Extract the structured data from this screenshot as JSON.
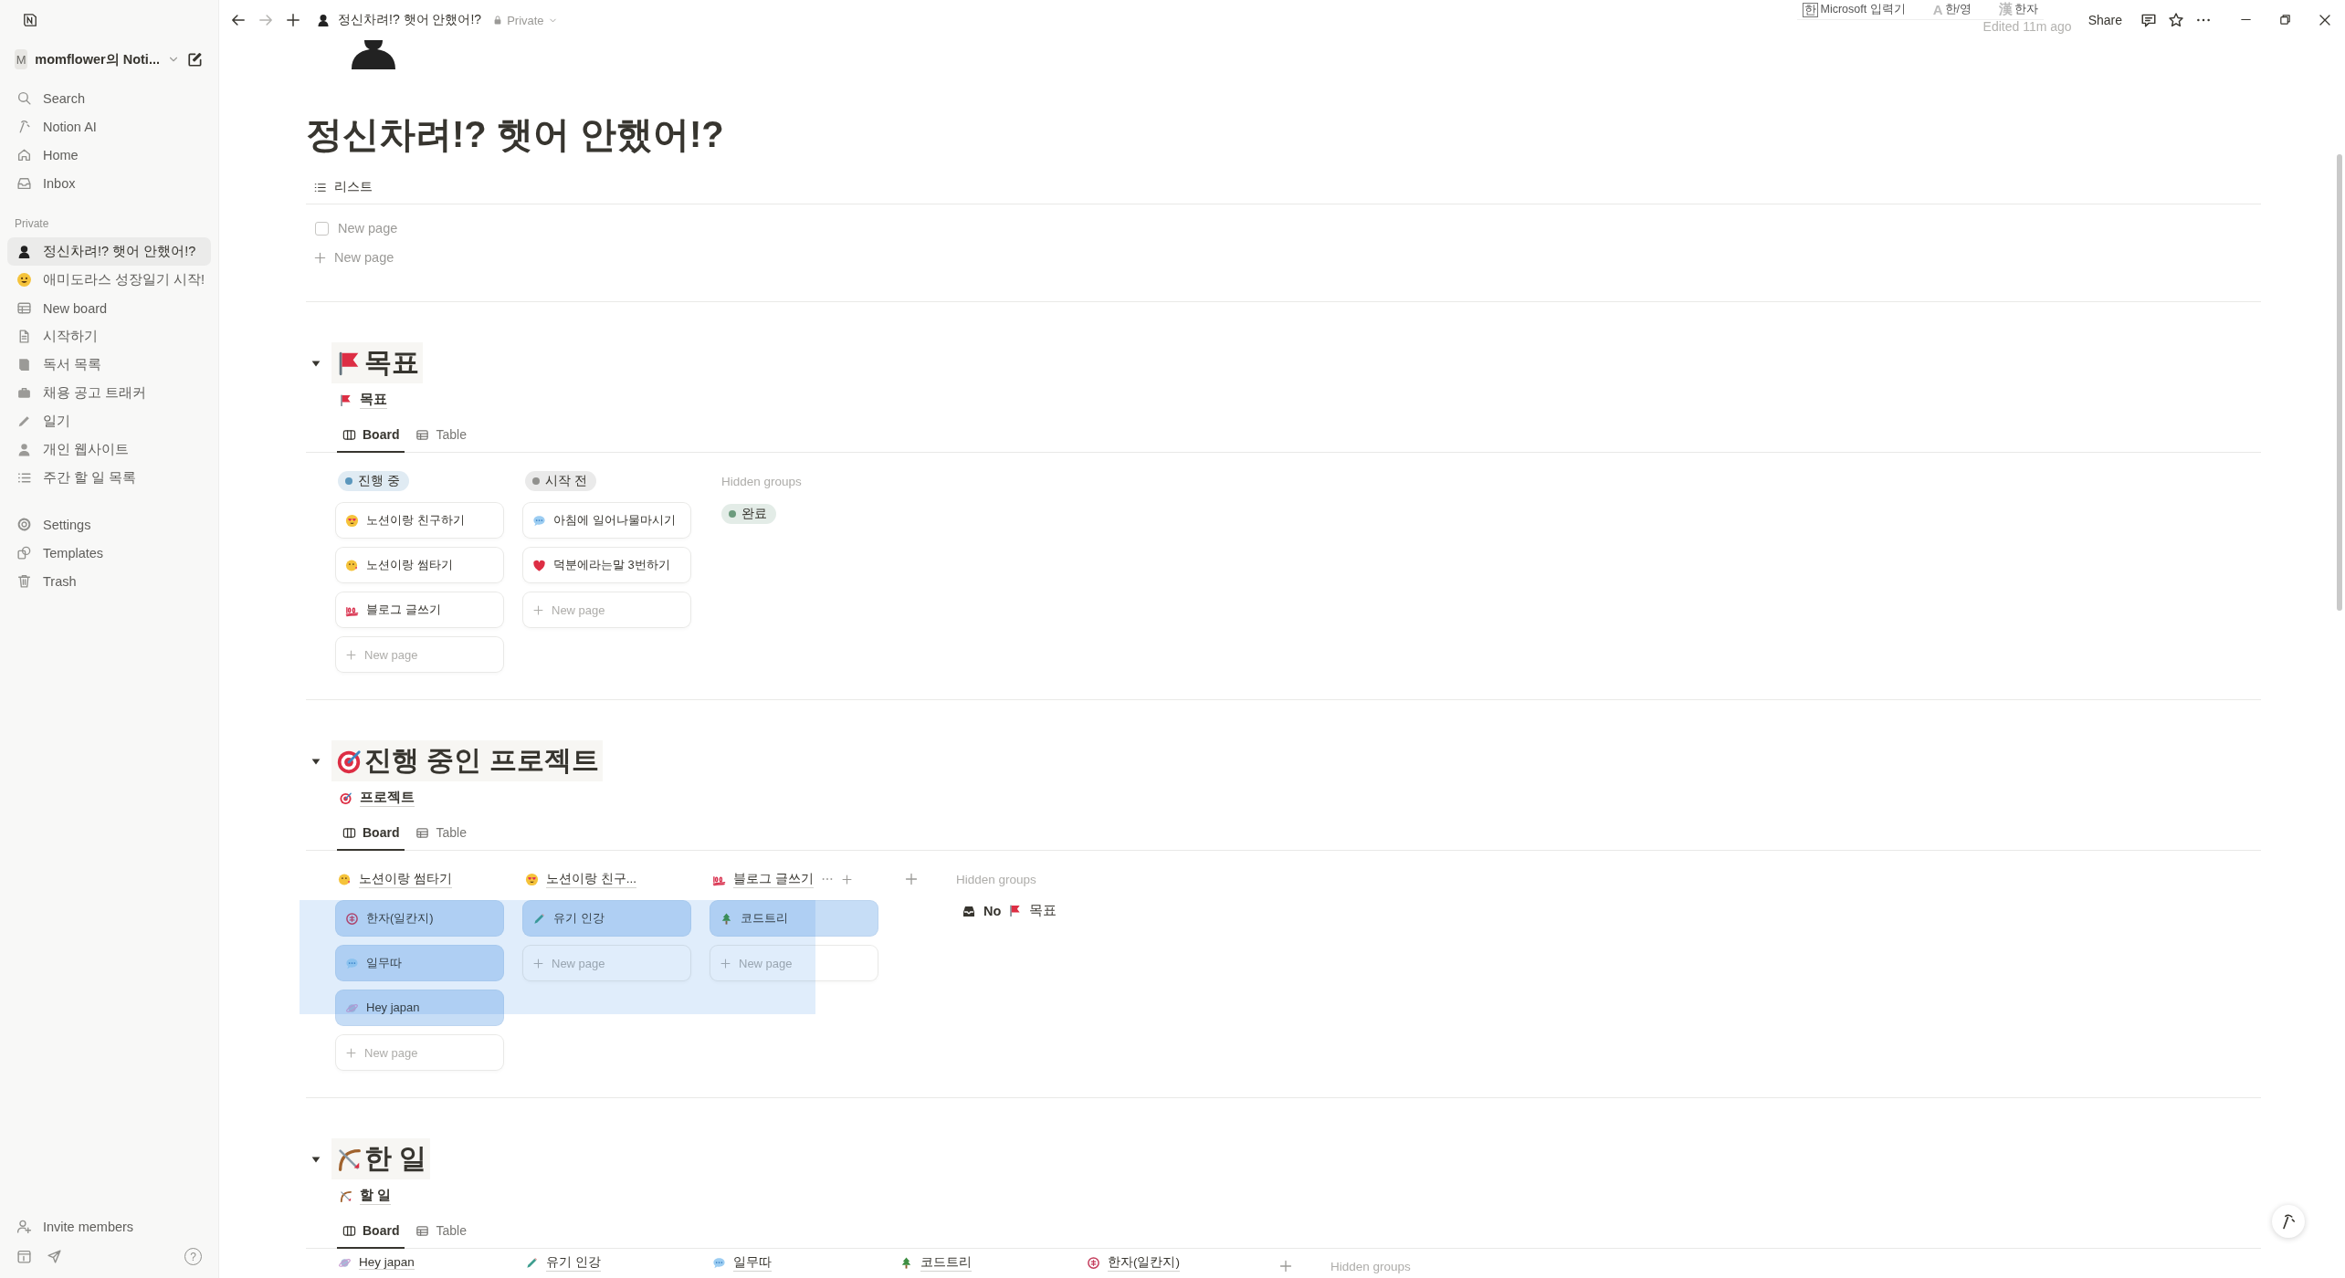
{
  "sidebar": {
    "workspace": {
      "initial": "M",
      "name": "momflower의 Noti..."
    },
    "nav": [
      {
        "label": "Search"
      },
      {
        "label": "Notion AI"
      },
      {
        "label": "Home"
      },
      {
        "label": "Inbox"
      }
    ],
    "section_label": "Private",
    "pages": [
      {
        "label": "정신차려!? 햇어 안했어!?",
        "selected": true
      },
      {
        "label": "애미도라스 성장일기 시작!",
        "selected": false
      },
      {
        "label": "New board",
        "selected": false
      },
      {
        "label": "시작하기",
        "selected": false
      },
      {
        "label": "독서 목록",
        "selected": false
      },
      {
        "label": "채용 공고 트래커",
        "selected": false
      },
      {
        "label": "일기",
        "selected": false
      },
      {
        "label": "개인 웹사이트",
        "selected": false
      },
      {
        "label": "주간 할 일 목록",
        "selected": false
      }
    ],
    "footer_nav": [
      {
        "label": "Settings"
      },
      {
        "label": "Templates"
      },
      {
        "label": "Trash"
      }
    ],
    "invite": "Invite members",
    "help": "?"
  },
  "topbar": {
    "breadcrumb": "정신차려!? 햇어 안했어!?",
    "privacy": "Private",
    "edited": "Edited 11m ago",
    "share": "Share"
  },
  "ime_bar": [
    {
      "glyph": "한",
      "label": "Microsoft 입력기"
    },
    {
      "glyph": "A",
      "label": "한/영"
    },
    {
      "glyph": "漢",
      "label": "한자"
    }
  ],
  "page": {
    "title": "정신차려!? 햇어 안했어!?",
    "list_view": {
      "tab": "리스트",
      "rows": [
        {
          "title": "New page",
          "checked": false
        }
      ],
      "add": "New page"
    },
    "sections": [
      {
        "heading": "목표",
        "expanded": true,
        "db_title": "목표",
        "views": [
          {
            "label": "Board",
            "selected": true
          },
          {
            "label": "Table",
            "selected": false
          }
        ],
        "add_group_button": false,
        "selection_rectangle": false,
        "groups": [
          {
            "kind": "status",
            "label": "진행 중",
            "color": "#5b97bd",
            "hovered": false,
            "cards": [
              {
                "title": "노션이랑 친구하기",
                "selected": false
              },
              {
                "title": "노션이랑 썸타기",
                "selected": false
              },
              {
                "title": "블로그 글쓰기",
                "selected": false
              }
            ],
            "add": "New page"
          },
          {
            "kind": "status",
            "label": "시작 전",
            "color": "#91918e",
            "hovered": false,
            "cards": [
              {
                "title": "아침에 일어나물마시기",
                "selected": false
              },
              {
                "title": "덕분에라는말 3번하기",
                "selected": false
              }
            ],
            "add": "New page"
          }
        ],
        "hidden_label": "Hidden groups",
        "hidden_groups": [
          {
            "kind": "status",
            "label": "완료",
            "color": "#6c9b7d"
          }
        ]
      },
      {
        "heading": "진행 중인 프로젝트",
        "expanded": true,
        "db_title": "프로젝트",
        "views": [
          {
            "label": "Board",
            "selected": true
          },
          {
            "label": "Table",
            "selected": false
          }
        ],
        "add_group_button": true,
        "selection_rectangle": true,
        "groups": [
          {
            "kind": "page",
            "label": "노션이랑 썸타기",
            "hovered": false,
            "cards": [
              {
                "title": "한자(일칸지)",
                "selected": true
              },
              {
                "title": "일무따",
                "selected": true
              },
              {
                "title": "Hey japan",
                "selected": true
              }
            ],
            "add": "New page"
          },
          {
            "kind": "page",
            "label": "노션이랑 친구...",
            "hovered": false,
            "cards": [
              {
                "title": "유기 인강",
                "selected": true
              }
            ],
            "add": "New page"
          },
          {
            "kind": "page",
            "label": "블로그 글쓰기",
            "hovered": true,
            "cards": [
              {
                "title": "코드트리",
                "selected": true
              }
            ],
            "add": "New page"
          }
        ],
        "hidden_label": "Hidden groups",
        "hidden_groups": [
          {
            "kind": "relation",
            "label": "No",
            "relation": "목표"
          }
        ]
      },
      {
        "heading": "한 일",
        "expanded": true,
        "db_title": "할 일",
        "views": [
          {
            "label": "Board",
            "selected": true
          },
          {
            "label": "Table",
            "selected": false
          }
        ],
        "add_group_button": true,
        "selection_rectangle": false,
        "groups": [
          {
            "kind": "page",
            "label": "Hey japan",
            "hovered": false
          },
          {
            "kind": "page",
            "label": "유기 인강",
            "hovered": false
          },
          {
            "kind": "page",
            "label": "일무따",
            "hovered": false
          },
          {
            "kind": "page",
            "label": "코드트리",
            "hovered": false
          },
          {
            "kind": "page",
            "label": "한자(일칸지)",
            "hovered": false
          }
        ],
        "hidden_label": "Hidden groups"
      }
    ]
  }
}
